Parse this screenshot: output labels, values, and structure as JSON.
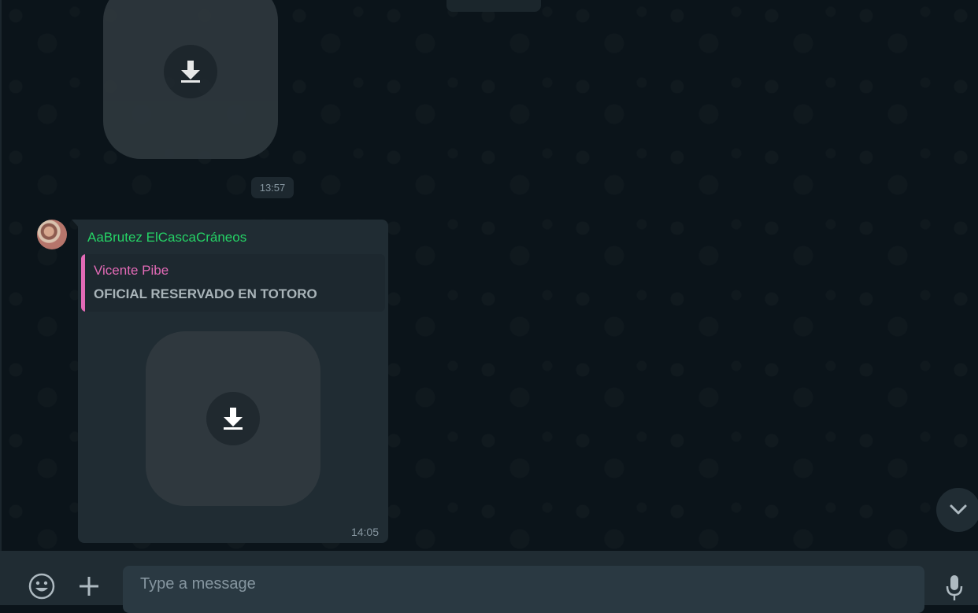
{
  "chat": {
    "earlier_time": "13:57",
    "message": {
      "sender": "AaBrutez ElCascaCráneos",
      "quote_author": "Vicente Pibe",
      "quote_text": "OFICIAL RESERVADO EN TOTORO",
      "time": "14:05"
    }
  },
  "composer": {
    "placeholder": "Type a message"
  },
  "icons": {
    "download": "download-arrow-icon",
    "emoji": "emoji-icon",
    "attach": "plus-icon",
    "mic": "microphone-icon",
    "scroll": "chevron-down-icon"
  },
  "colors": {
    "background": "#0b141a",
    "bubble": "#202c33",
    "sender": "#25d366",
    "quote_author": "#e26ab6"
  }
}
